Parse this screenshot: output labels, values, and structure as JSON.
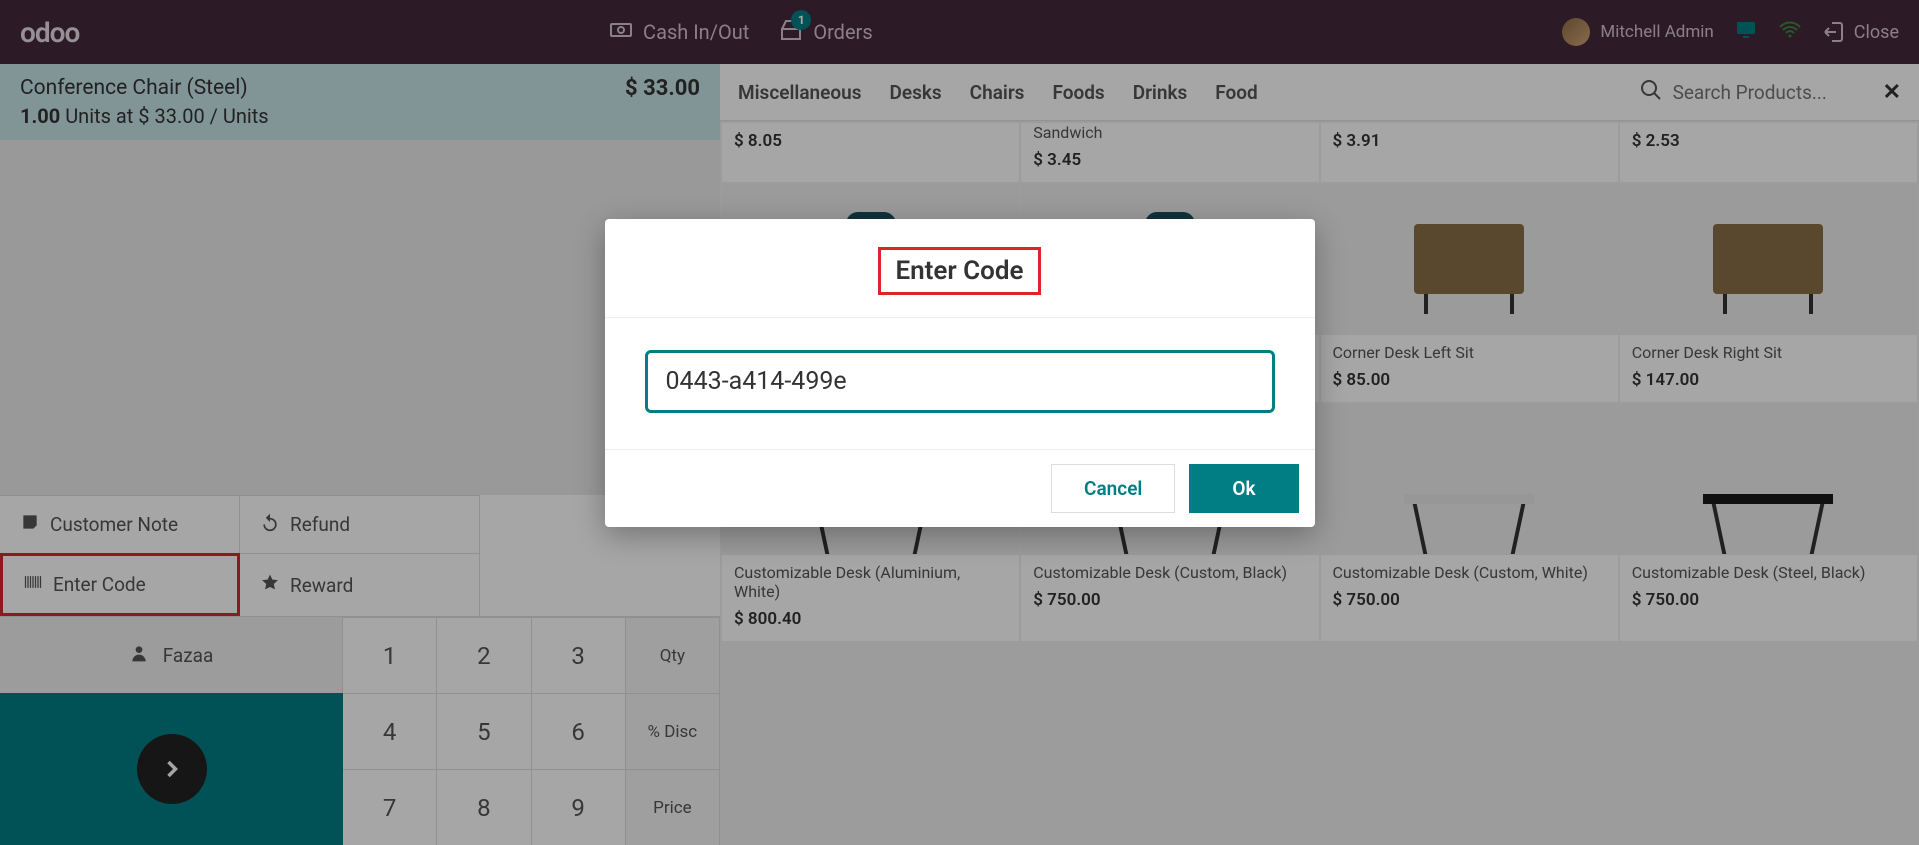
{
  "header": {
    "logo": "odoo",
    "cash_label": "Cash In/Out",
    "orders_label": "Orders",
    "orders_badge": "1",
    "user_name": "Mitchell Admin",
    "close_label": "Close"
  },
  "order": {
    "item_name": "Conference Chair (Steel)",
    "qty_value": "1.00",
    "qty_line_rest": " Units at $ 33.00 / Units",
    "price": "$ 33.00"
  },
  "actions": {
    "customer_note": "Customer Note",
    "refund": "Refund",
    "enter_code": "Enter Code",
    "reward": "Reward",
    "customer_name": "Fazaa"
  },
  "numpad": {
    "keys": [
      "1",
      "2",
      "3",
      "Qty",
      "4",
      "5",
      "6",
      "% Disc",
      "7",
      "8",
      "9",
      "Price"
    ]
  },
  "categories": [
    "Miscellaneous",
    "Desks",
    "Chairs",
    "Foods",
    "Drinks",
    "Food"
  ],
  "search_placeholder": "Search Products...",
  "products_row0": [
    {
      "name": "",
      "price": "$ 8.05"
    },
    {
      "name": "Sandwich",
      "price": "$ 3.45"
    },
    {
      "name": "",
      "price": "$ 3.91"
    },
    {
      "name": "",
      "price": "$ 2.53"
    }
  ],
  "products_row1": [
    {
      "name": "",
      "price": ""
    },
    {
      "name": "",
      "price": ""
    },
    {
      "name": "Corner Desk Left Sit",
      "price": "$ 85.00"
    },
    {
      "name": "Corner Desk Right Sit",
      "price": "$ 147.00"
    }
  ],
  "products_row2": [
    {
      "name": "Customizable Desk (Aluminium, White)",
      "price": "$ 800.40"
    },
    {
      "name": "Customizable Desk (Custom, Black)",
      "price": "$ 750.00"
    },
    {
      "name": "Customizable Desk (Custom, White)",
      "price": "$ 750.00"
    },
    {
      "name": "Customizable Desk (Steel, Black)",
      "price": "$ 750.00"
    }
  ],
  "modal": {
    "title": "Enter Code",
    "value": "0443-a414-499e",
    "cancel": "Cancel",
    "ok": "Ok"
  }
}
